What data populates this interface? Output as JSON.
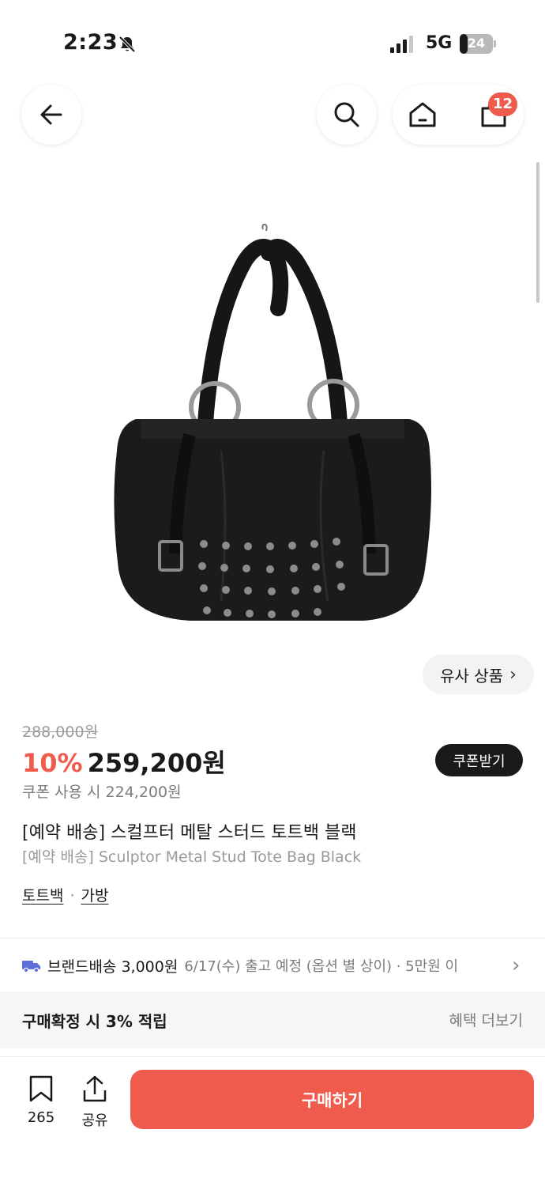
{
  "status_bar": {
    "time": "2:23",
    "network": "5G",
    "battery": "24",
    "battery_level": 0.24
  },
  "nav": {
    "cart_count": "12"
  },
  "similar_products": {
    "label": "유사 상품"
  },
  "pricing": {
    "original_price": "288,000원",
    "discount_rate": "10%",
    "sale_price": "259,200원",
    "coupon_button": "쿠폰받기",
    "coupon_price": "쿠폰 사용 시 224,200원"
  },
  "product": {
    "title_ko": "[예약 배송] 스컬프터 메탈 스터드 토트백 블랙",
    "title_en": "[예약 배송] Sculptor Metal Stud Tote Bag Black",
    "categories": [
      "토트백",
      "가방"
    ],
    "category_separator": "·"
  },
  "shipping": {
    "brand": "브랜드배송 3,000원",
    "detail": "6/17(수) 출고 예정 (옵션 별 상이) · 5만원 이"
  },
  "benefit": {
    "title": "구매확정 시 3% 적립",
    "more": "혜택 더보기"
  },
  "bottom_bar": {
    "bookmark_count": "265",
    "share_label": "공유",
    "buy_label": "구매하기"
  },
  "colors": {
    "accent": "#ef5b4c",
    "dark": "#1a1a1a",
    "muted": "#7c7c7c"
  }
}
